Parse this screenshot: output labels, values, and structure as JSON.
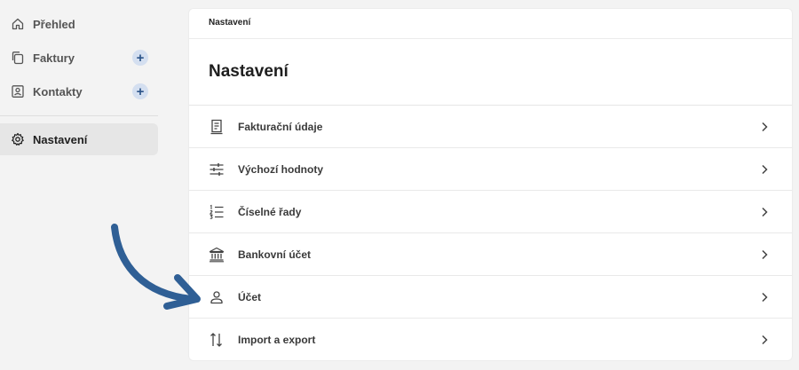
{
  "sidebar": {
    "items": [
      {
        "label": "Přehled",
        "icon": "home-icon",
        "has_add": false,
        "active": false
      },
      {
        "label": "Faktury",
        "icon": "documents-icon",
        "has_add": true,
        "active": false
      },
      {
        "label": "Kontakty",
        "icon": "contact-card-icon",
        "has_add": true,
        "active": false
      },
      {
        "label": "Nastavení",
        "icon": "gear-icon",
        "has_add": false,
        "active": true
      }
    ],
    "add_label": "+"
  },
  "main": {
    "breadcrumb": "Nastavení",
    "title": "Nastavení",
    "settings_items": [
      {
        "label": "Fakturační údaje",
        "icon": "receipt-icon"
      },
      {
        "label": "Výchozí hodnoty",
        "icon": "sliders-icon"
      },
      {
        "label": "Číselné řady",
        "icon": "numbered-list-icon"
      },
      {
        "label": "Bankovní účet",
        "icon": "bank-icon"
      },
      {
        "label": "Účet",
        "icon": "user-icon"
      },
      {
        "label": "Import a export",
        "icon": "import-export-icon"
      }
    ]
  },
  "colors": {
    "background": "#f3f3f3",
    "card": "#ffffff",
    "accent_plus_bg": "#d4dff0",
    "accent_plus_fg": "#2c5489",
    "arrow": "#2f5f95"
  }
}
